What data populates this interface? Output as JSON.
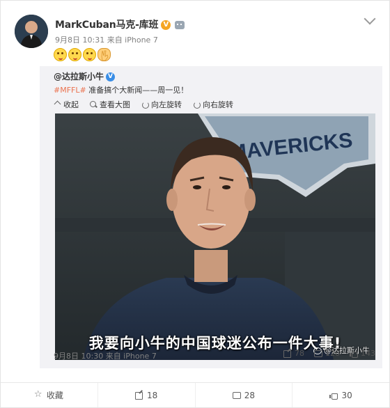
{
  "post": {
    "user_name": "MarkCuban马克-库班",
    "verify_badge": "V",
    "meta": "9月8日 10:31 来自 iPhone 7",
    "emojis": [
      "blush-emoji",
      "flushed-emoji",
      "hand-over-mouth-emoji",
      "victory-hand-emoji"
    ]
  },
  "repost": {
    "user_name": "@达拉斯小牛",
    "verify_badge": "V",
    "hashtag": "#MFFL#",
    "text": " 准备搞个大新闻——周一见！",
    "actions": {
      "collapse": "收起",
      "view_large": "查看大图",
      "rotate_left": "向左旋转",
      "rotate_right": "向右旋转"
    },
    "video": {
      "caption": "我要向小牛的中国球迷公布一件大事!",
      "watermark": "@达拉斯小牛",
      "banner_text": "MAVERICKS"
    },
    "meta": "9月8日 10:30 来自 iPhone 7",
    "stats": {
      "shares": "78",
      "comments": "120",
      "likes": "143"
    }
  },
  "bottom_bar": {
    "favorite": "收藏",
    "shares": "18",
    "comments": "28",
    "likes": "30"
  },
  "colors": {
    "hashtag": "#eb7350",
    "verify_gold": "#f5a623",
    "verify_blue": "#3a8ee6"
  }
}
